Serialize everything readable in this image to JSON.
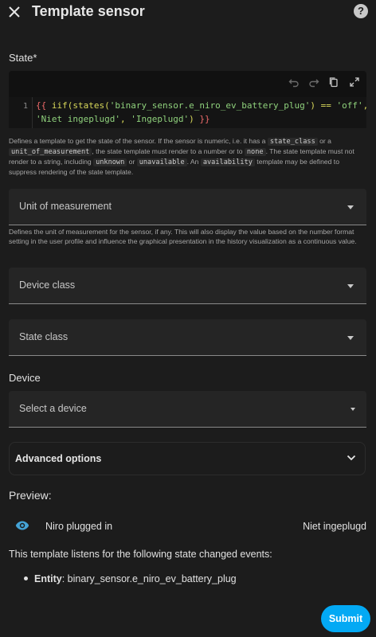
{
  "header": {
    "title": "Template sensor",
    "close_icon": "close-icon",
    "help_icon": "help-circle-icon",
    "help_glyph": "?"
  },
  "state": {
    "label": "State*",
    "toolbar_icons": [
      "undo-icon",
      "redo-icon",
      "copy-icon",
      "fullscreen-icon"
    ],
    "line_number": "1",
    "code": {
      "open_brace": "{{",
      "fn": " iif(states(",
      "entity_str": "'binary_sensor.e_niro_ev_battery_plug'",
      "eq": ") == ",
      "off_str": "'off'",
      "comma1": ",",
      "line2_str1": "'Niet ingeplugd'",
      "comma2": ", ",
      "line2_str2": "'Ingeplugd'",
      "close_paren": ") ",
      "close_brace": "}}"
    },
    "helper": {
      "t1": "Defines a template to get the state of the sensor. If the sensor is numeric, i.e. it has a ",
      "chip1": "state_class",
      "t2": " or a ",
      "chip2": "unit_of_measurement",
      "t3": ", the state template must render to a number or to ",
      "chip3": "none",
      "t4": ". The state template must not render to a string, including ",
      "chip4": "unknown",
      "t5": " or ",
      "chip5": "unavailable",
      "t6": ". An ",
      "chip6": "availability",
      "t7": " template may be defined to suppress rendering of the state template."
    }
  },
  "unit": {
    "label": "Unit of measurement",
    "helper": "Defines the unit of measurement for the sensor, if any. This will also display the value based on the number format setting in the user profile and influence the graphical presentation in the history visualization as a continuous value."
  },
  "device_class": {
    "label": "Device class"
  },
  "state_class": {
    "label": "State class"
  },
  "device": {
    "section_label": "Device",
    "placeholder": "Select a device"
  },
  "advanced": {
    "label": "Advanced options"
  },
  "preview": {
    "label": "Preview:",
    "icon": "eye-icon",
    "entity_name": "Niro plugged in",
    "entity_state": "Niet ingeplugd",
    "listen_text": "This template listens for the following state changed events:",
    "bullet_label": "Entity",
    "bullet_value": ": binary_sensor.e_niro_ev_battery_plug"
  },
  "submit_label": "Submit",
  "colors": {
    "accent": "#03a9f4",
    "background": "#1c1c1c",
    "field_bg": "#252525"
  }
}
